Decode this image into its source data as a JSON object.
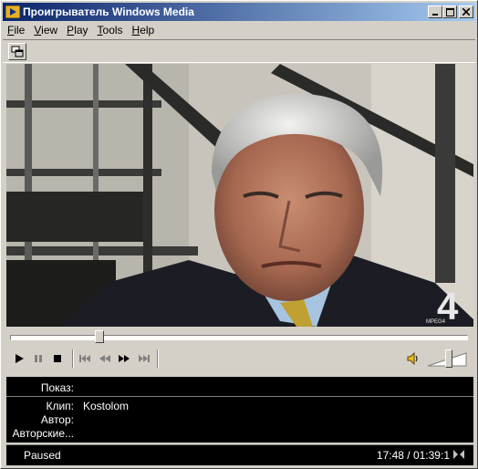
{
  "window": {
    "title": "Проигрыватель Windows Media"
  },
  "menu": [
    {
      "label": "File",
      "accel": "F",
      "rest": "ile"
    },
    {
      "label": "View",
      "accel": "V",
      "rest": "iew"
    },
    {
      "label": "Play",
      "accel": "P",
      "rest": "lay"
    },
    {
      "label": "Tools",
      "accel": "T",
      "rest": "ools"
    },
    {
      "label": "Help",
      "accel": "H",
      "rest": "elp"
    }
  ],
  "video": {
    "watermark": "4",
    "watermark_sub": "MPEG4"
  },
  "seek": {
    "progress": 0.19
  },
  "volume": {
    "level": 0.55
  },
  "info": {
    "show_label": "Показ:",
    "show_value": "",
    "clip_label": "Клип:",
    "clip_value": "Kostolom",
    "author_label": "Автор:",
    "author_value": "",
    "copyright_label": "Авторские...",
    "copyright_value": ""
  },
  "status": {
    "state": "Paused",
    "time": "17:48 / 01:39:1"
  },
  "colors": {
    "titlebar_start": "#0a246a",
    "titlebar_end": "#a6caf0",
    "face": "#d4d0c8",
    "info_bg": "#000000"
  }
}
